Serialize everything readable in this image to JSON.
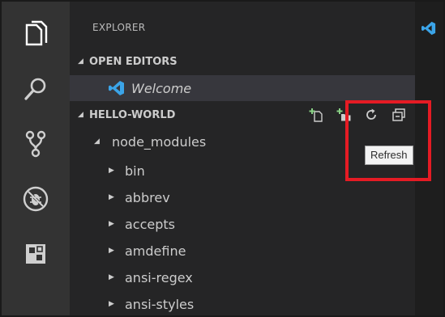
{
  "activity_bar": {
    "icons": [
      "explorer-icon",
      "search-icon",
      "source-control-icon",
      "debug-icon",
      "extensions-icon"
    ]
  },
  "explorer": {
    "title": "EXPLORER",
    "open_editors": {
      "label": "OPEN EDITORS",
      "items": [
        {
          "label": "Welcome",
          "icon": "vscode-logo-icon"
        }
      ]
    },
    "project": {
      "label": "HELLO-WORLD",
      "actions": [
        "new-file-icon",
        "new-folder-icon",
        "refresh-icon",
        "collapse-all-icon"
      ],
      "tree": {
        "folder": "node_modules",
        "children": [
          "bin",
          "abbrev",
          "accepts",
          "amdefine",
          "ansi-regex",
          "ansi-styles"
        ]
      }
    }
  },
  "tooltip": {
    "text": "Refresh"
  },
  "colors": {
    "accent": "#007acc",
    "highlight": "#e51b24",
    "add_green": "#89d185"
  }
}
